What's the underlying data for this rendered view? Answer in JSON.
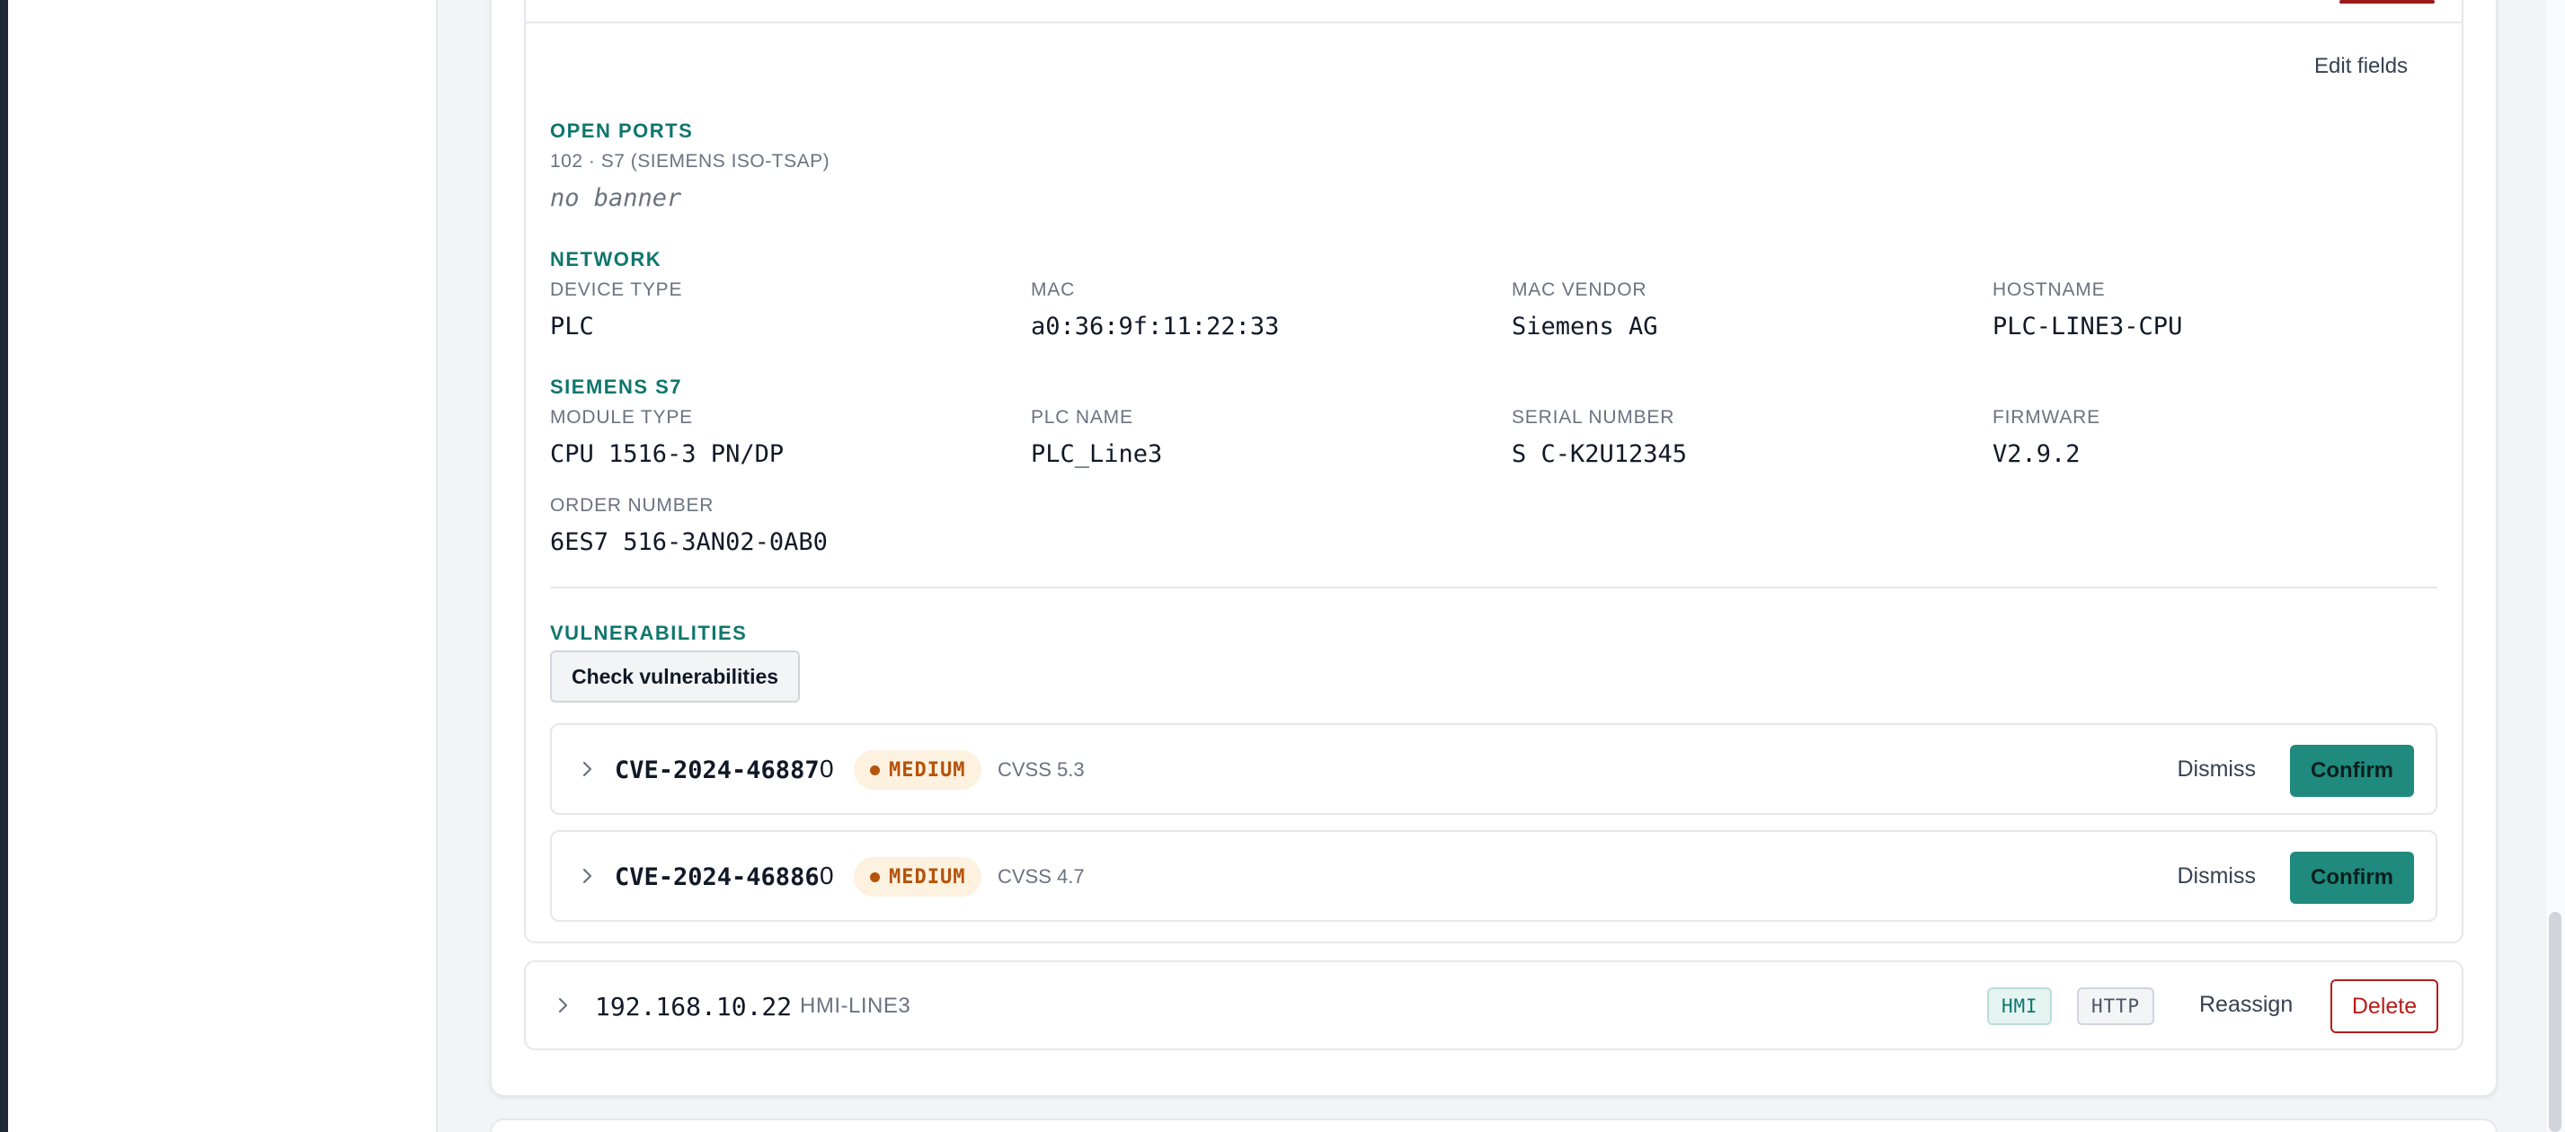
{
  "details": {
    "edit_fields_label": "Edit fields",
    "open_ports": {
      "title": "OPEN PORTS",
      "port_line": "102 · S7 (SIEMENS ISO-TSAP)",
      "banner": "no banner"
    },
    "network": {
      "title": "NETWORK",
      "fields": [
        {
          "label": "DEVICE TYPE",
          "value": "PLC"
        },
        {
          "label": "MAC",
          "value": "a0:36:9f:11:22:33"
        },
        {
          "label": "MAC VENDOR",
          "value": "Siemens AG"
        },
        {
          "label": "HOSTNAME",
          "value": "PLC-LINE3-CPU"
        }
      ]
    },
    "siemens": {
      "title": "SIEMENS S7",
      "fields": [
        {
          "label": "MODULE TYPE",
          "value": "CPU 1516-3 PN/DP"
        },
        {
          "label": "PLC NAME",
          "value": "PLC_Line3"
        },
        {
          "label": "SERIAL NUMBER",
          "value": "S C-K2U12345"
        },
        {
          "label": "FIRMWARE",
          "value": "V2.9.2"
        },
        {
          "label": "ORDER NUMBER",
          "value": "6ES7 516-3AN02-0AB0"
        }
      ]
    },
    "vulnerabilities": {
      "title": "VULNERABILITIES",
      "check_button": "Check vulnerabilities",
      "items": [
        {
          "id": "CVE-2024-46887",
          "count": "0",
          "severity": "MEDIUM",
          "cvss": "CVSS 5.3",
          "dismiss": "Dismiss",
          "confirm": "Confirm"
        },
        {
          "id": "CVE-2024-46886",
          "count": "0",
          "severity": "MEDIUM",
          "cvss": "CVSS 4.7",
          "dismiss": "Dismiss",
          "confirm": "Confirm"
        }
      ]
    }
  },
  "next_device": {
    "ip": "192.168.10.22",
    "hostname": "HMI-LINE3",
    "tags": [
      "HMI",
      "HTTP"
    ],
    "reassign_label": "Reassign",
    "delete_label": "Delete"
  },
  "colors": {
    "accent": "#0f766e",
    "confirm_bg": "#1f8a7d",
    "danger": "#b91c1c",
    "severity_medium": "#b45309"
  },
  "icons": {
    "expand": "chevron-right-icon",
    "severity": "dot-icon"
  }
}
